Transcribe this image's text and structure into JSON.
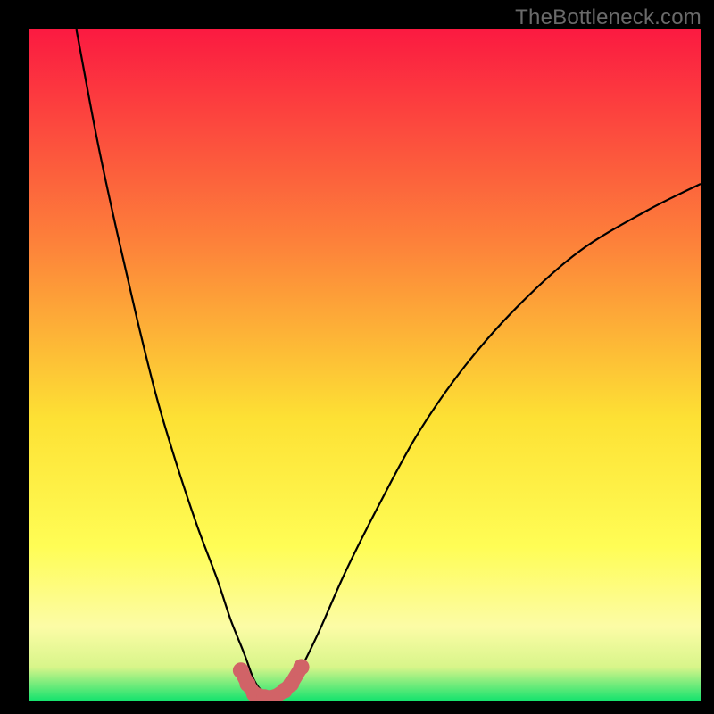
{
  "watermark": "TheBottleneck.com",
  "colors": {
    "gradient_top": "#fb1a41",
    "gradient_mid_upper": "#fd823a",
    "gradient_mid": "#fde134",
    "gradient_mid_lower": "#fffd55",
    "gradient_band": "#fcfca6",
    "gradient_bottom": "#16e36e",
    "curve": "#000000",
    "marker_fill": "#d16367",
    "frame": "#000000"
  },
  "chart_data": {
    "type": "line",
    "title": "",
    "xlabel": "",
    "ylabel": "",
    "xlim": [
      0,
      100
    ],
    "ylim": [
      0,
      100
    ],
    "minimum_at_x": 35.5,
    "series": [
      {
        "name": "bottleneck-curve",
        "x": [
          7,
          10,
          13,
          16,
          19,
          22,
          25,
          28,
          30,
          32,
          33.5,
          35,
          36,
          37,
          38,
          40,
          43,
          47,
          52,
          58,
          65,
          73,
          82,
          92,
          100
        ],
        "y": [
          100,
          84,
          70,
          57,
          45,
          35,
          26,
          18,
          12,
          7,
          3,
          1,
          0.5,
          0.6,
          1.5,
          4,
          10,
          19,
          29,
          40,
          50,
          59,
          67,
          73,
          77
        ]
      },
      {
        "name": "bottom-markers",
        "x": [
          31.5,
          32.5,
          33.5,
          35.0,
          36.5,
          38.0,
          39.0,
          40.5
        ],
        "y": [
          4.5,
          2.5,
          1.0,
          0.5,
          0.5,
          1.5,
          2.5,
          5.0
        ]
      }
    ]
  }
}
